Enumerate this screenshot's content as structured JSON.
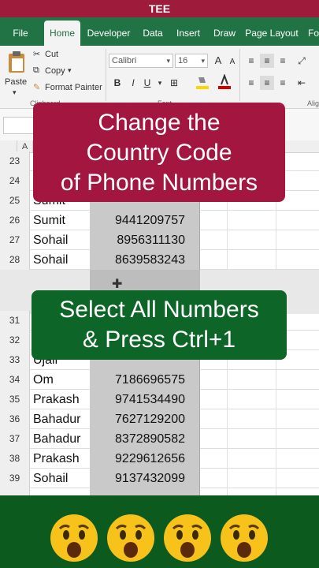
{
  "app": {
    "title": "TEE"
  },
  "tabs": [
    "File",
    "Home",
    "Developer",
    "Data",
    "Insert",
    "Draw",
    "Page Layout",
    "Fo"
  ],
  "ribbon": {
    "paste": "Paste",
    "cut": "Cut",
    "copy": "Copy",
    "format_painter": "Format Painter",
    "clipboard_group": "Clipboard",
    "font_group": "Font",
    "align_group": "Alig",
    "font_name": "Calibri",
    "font_size": "16",
    "bold": "B",
    "italic": "I",
    "underline": "U",
    "grow_font": "A",
    "shrink_font": "A"
  },
  "grid": {
    "col_a": "A",
    "rows": [
      {
        "num": "23",
        "name": "",
        "phone": ""
      },
      {
        "num": "24",
        "name": "",
        "phone": ""
      },
      {
        "num": "25",
        "name": "Sumit",
        "phone": ""
      },
      {
        "num": "26",
        "name": "Sumit",
        "phone": "9441209757"
      },
      {
        "num": "27",
        "name": "Sohail",
        "phone": "8956311130"
      },
      {
        "num": "28",
        "name": "Sohail",
        "phone": "8639583243"
      },
      {
        "num": "31",
        "name": "",
        "phone": ""
      },
      {
        "num": "32",
        "name": "",
        "phone": ""
      },
      {
        "num": "33",
        "name": "Ujali",
        "phone": ""
      },
      {
        "num": "34",
        "name": "Om",
        "phone": "7186696575"
      },
      {
        "num": "35",
        "name": "Prakash",
        "phone": "9741534490"
      },
      {
        "num": "36",
        "name": "Bahadur",
        "phone": "7627129200"
      },
      {
        "num": "37",
        "name": "Bahadur",
        "phone": "8372890582"
      },
      {
        "num": "38",
        "name": "Prakash",
        "phone": "9229612656"
      },
      {
        "num": "39",
        "name": "Sohail",
        "phone": "9137432099"
      }
    ]
  },
  "overlay": {
    "top_line1": "Change the",
    "top_line2": "Country Code",
    "top_line3": "of Phone Numbers",
    "mid_line1": "Select All Numbers",
    "mid_line2": "& Press Ctrl+1"
  },
  "colors": {
    "excel_green": "#217346",
    "title_red": "#9e1b3c",
    "banner_red": "#a3163f",
    "banner_green": "#0d6627",
    "selection_gray": "#c9c9c9"
  }
}
